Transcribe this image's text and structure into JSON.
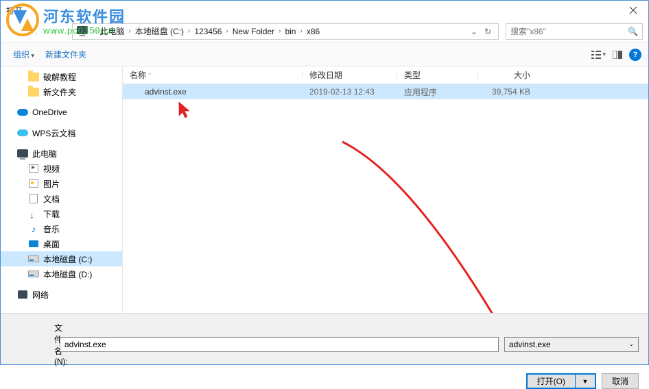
{
  "window": {
    "title": "打开"
  },
  "watermark": {
    "cn": "河东软件园",
    "url": "www.pc0359.cn"
  },
  "breadcrumb": {
    "items": [
      "此电脑",
      "本地磁盘 (C:)",
      "123456",
      "New Folder",
      "bin",
      "x86"
    ]
  },
  "search": {
    "placeholder": "搜索\"x86\""
  },
  "toolbar": {
    "organize": "组织",
    "newfolder": "新建文件夹"
  },
  "sidebar": {
    "items": [
      {
        "label": "破解教程",
        "icon": "folder",
        "l2": true
      },
      {
        "label": "新文件夹",
        "icon": "folder",
        "l2": true
      },
      {
        "label": "OneDrive",
        "icon": "onedrive",
        "space_before": true
      },
      {
        "label": "WPS云文档",
        "icon": "wps",
        "space_before": true
      },
      {
        "label": "此电脑",
        "icon": "pc",
        "space_before": true
      },
      {
        "label": "视频",
        "icon": "video",
        "l2": true
      },
      {
        "label": "图片",
        "icon": "image",
        "l2": true
      },
      {
        "label": "文档",
        "icon": "doc",
        "l2": true
      },
      {
        "label": "下载",
        "icon": "download",
        "l2": true
      },
      {
        "label": "音乐",
        "icon": "music",
        "l2": true
      },
      {
        "label": "桌面",
        "icon": "desktop",
        "l2": true
      },
      {
        "label": "本地磁盘 (C:)",
        "icon": "disk",
        "l2": true,
        "selected": true
      },
      {
        "label": "本地磁盘 (D:)",
        "icon": "disk",
        "l2": true
      },
      {
        "label": "网络",
        "icon": "net",
        "space_before": true
      }
    ]
  },
  "fileview": {
    "columns": {
      "name": "名称",
      "date": "修改日期",
      "type": "类型",
      "size": "大小"
    },
    "rows": [
      {
        "name": "advinst.exe",
        "date": "2019-02-13 12:43",
        "type": "应用程序",
        "size": "39,754 KB",
        "selected": true
      }
    ]
  },
  "bottom": {
    "filename_label": "文件名(N):",
    "filename_value": "advinst.exe",
    "filetype": "advinst.exe",
    "open": "打开(O)",
    "cancel": "取消"
  }
}
